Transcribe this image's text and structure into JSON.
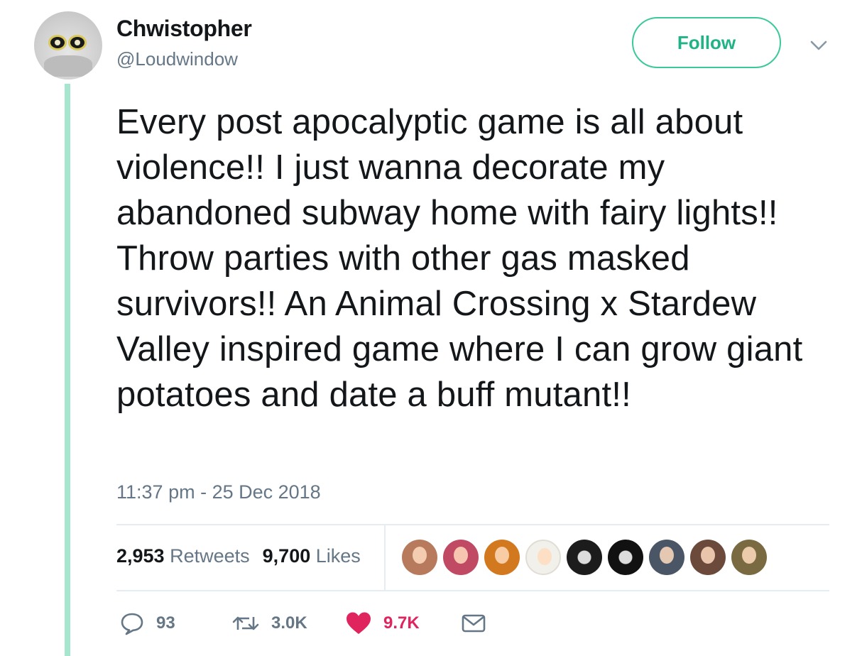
{
  "author": {
    "display_name": "Chwistopher",
    "handle": "@Loudwindow"
  },
  "header": {
    "follow_label": "Follow"
  },
  "tweet": {
    "text": "Every post apocalyptic game is all about violence!! I just wanna decorate my abandoned subway home with fairy lights!! Throw parties with other gas masked survivors!! An Animal Crossing x Stardew Valley inspired game where I can grow giant potatoes and date a buff mutant!!",
    "timestamp": "11:37 pm - 25 Dec 2018"
  },
  "stats": {
    "retweets_count": "2,953",
    "retweets_label": "Retweets",
    "likes_count": "9,700",
    "likes_label": "Likes"
  },
  "likers": [
    {
      "name": "liker-avatar-1",
      "color": "#b77a5c"
    },
    {
      "name": "liker-avatar-2",
      "color": "#c04a64"
    },
    {
      "name": "liker-avatar-3",
      "color": "#d2781e"
    },
    {
      "name": "liker-avatar-4",
      "color": "#f2f0ea"
    },
    {
      "name": "liker-avatar-5",
      "color": "#1c1c1c"
    },
    {
      "name": "liker-avatar-6",
      "color": "#111111"
    },
    {
      "name": "liker-avatar-7",
      "color": "#4a5666"
    },
    {
      "name": "liker-avatar-8",
      "color": "#6b4a3c"
    },
    {
      "name": "liker-avatar-9",
      "color": "#7a6a42"
    }
  ],
  "actions": {
    "reply_count": "93",
    "retweet_count": "3.0K",
    "like_count": "9.7K"
  },
  "colors": {
    "accent": "#1fb386",
    "thread_line": "#a6e6cf",
    "like": "#e0245e",
    "secondary_text": "#657786"
  }
}
